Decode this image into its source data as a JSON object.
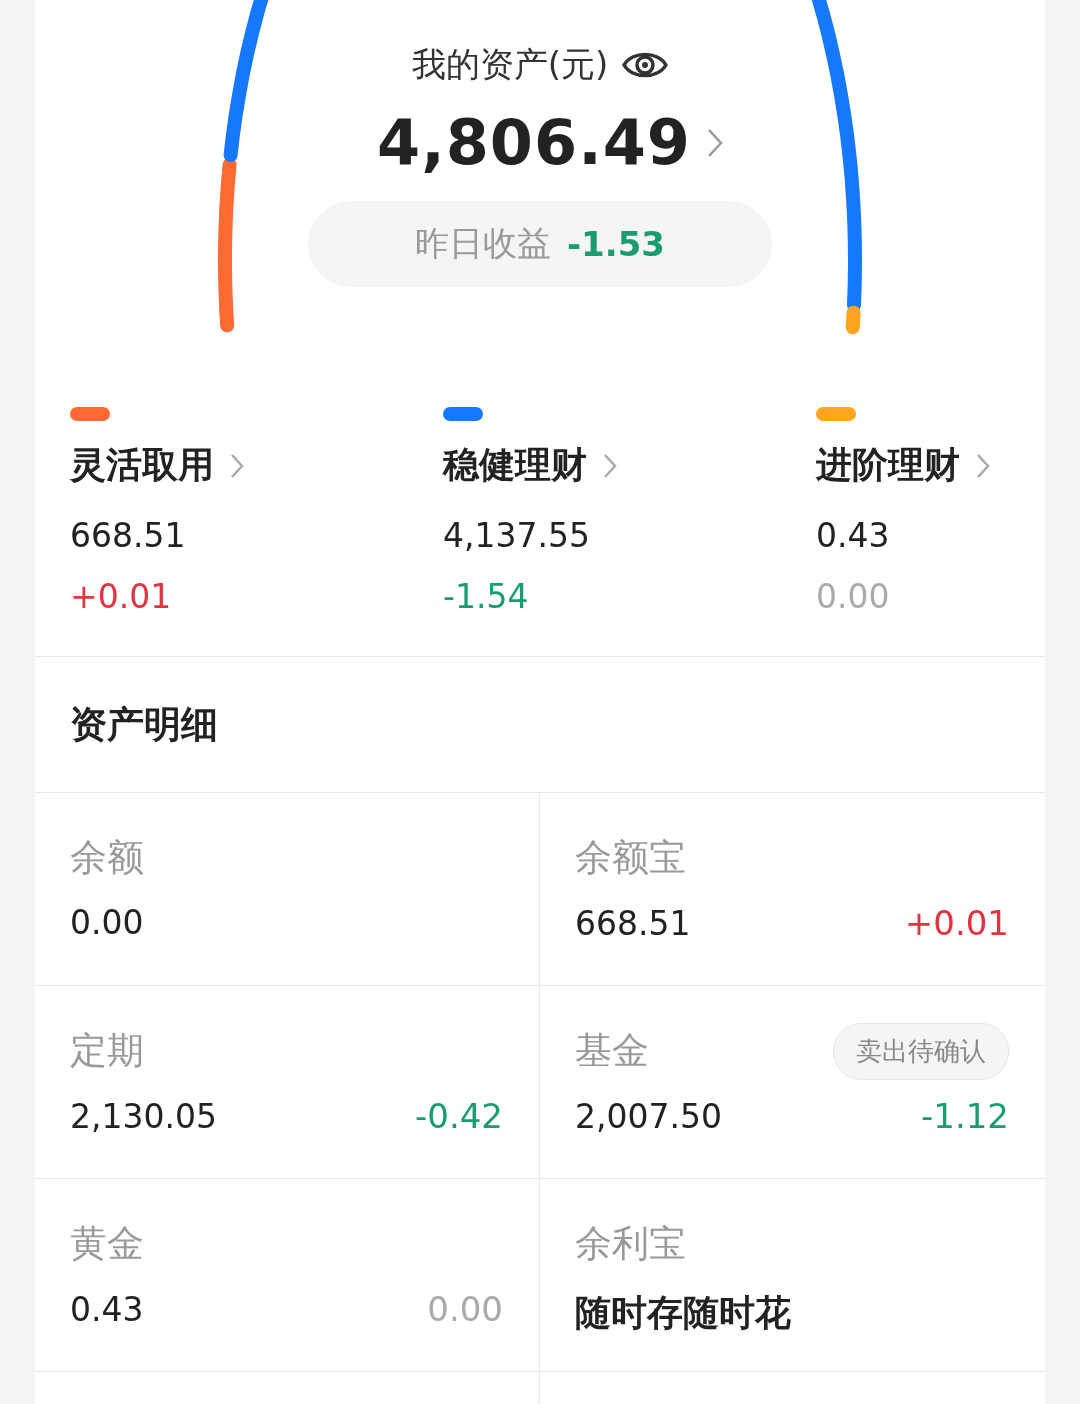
{
  "summary": {
    "title": "我的资产(元)",
    "total": "4,806.49",
    "yesterday_label": "昨日收益",
    "yesterday_change": {
      "text": "-1.53",
      "color": "#1b9b70"
    }
  },
  "categories": [
    {
      "name": "灵活取用",
      "value": "668.51",
      "change": {
        "text": "+0.01",
        "color": "#e0343f"
      },
      "color": "#ff6a33"
    },
    {
      "name": "稳健理财",
      "value": "4,137.55",
      "change": {
        "text": "-1.54",
        "color": "#1b9b70"
      },
      "color": "#1677ff"
    },
    {
      "name": "进阶理财",
      "value": "0.43",
      "change": {
        "text": "0.00",
        "color": "#aaaaaa"
      },
      "color": "#ffa51f"
    }
  ],
  "details": {
    "title": "资产明细",
    "items": [
      {
        "kind": "amount",
        "label": "余额",
        "value": "0.00"
      },
      {
        "kind": "amount",
        "label": "余额宝",
        "value": "668.51",
        "change": {
          "text": "+0.01",
          "color": "#e0343f"
        }
      },
      {
        "kind": "amount",
        "label": "定期",
        "value": "2,130.05",
        "change": {
          "text": "-0.42",
          "color": "#1b9b70"
        }
      },
      {
        "kind": "amount",
        "label": "基金",
        "value": "2,007.50",
        "change": {
          "text": "-1.12",
          "color": "#1b9b70"
        },
        "badge": "卖出待确认"
      },
      {
        "kind": "amount",
        "label": "黄金",
        "value": "0.43",
        "change": {
          "text": "0.00",
          "color": "#aaaaaa"
        }
      },
      {
        "kind": "slogan",
        "label": "余利宝",
        "value": "随时存随时花"
      }
    ]
  }
}
